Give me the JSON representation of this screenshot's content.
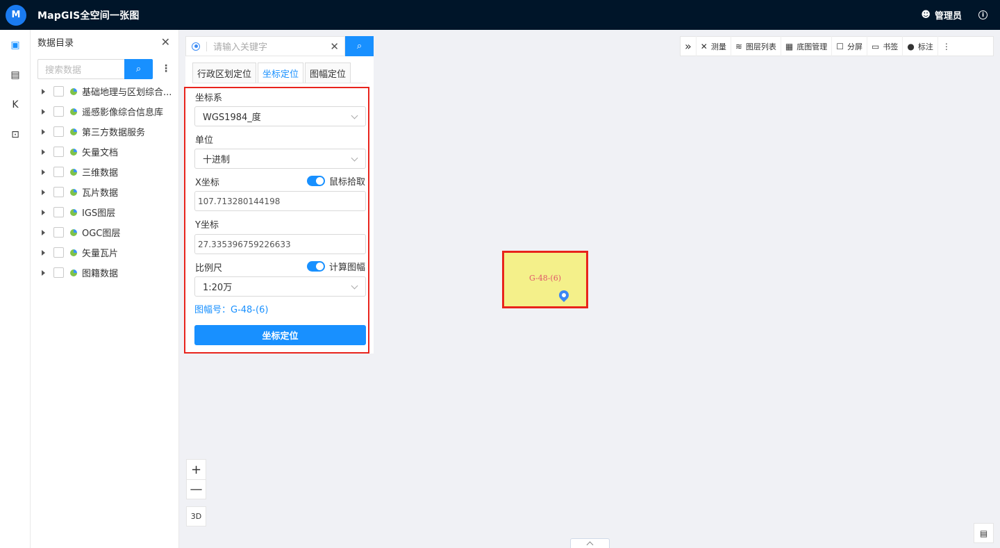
{
  "header": {
    "logo_text": "M",
    "title": "MapGIS全空间一张图",
    "user_icon": "user-icon",
    "user_label": "管理员",
    "info_icon": "i"
  },
  "rail": [
    {
      "icon": "cube-icon",
      "glyph": "▣",
      "active": true
    },
    {
      "icon": "dashboard-icon",
      "glyph": "▤",
      "active": false
    },
    {
      "icon": "k-icon",
      "glyph": "K",
      "active": false
    },
    {
      "icon": "monitor-icon",
      "glyph": "⊡",
      "active": false
    }
  ],
  "catalog": {
    "title": "数据目录",
    "close": "✕",
    "search_placeholder": "搜索数据",
    "search_btn": "⌕",
    "more": "⋮",
    "items": [
      {
        "label": "基础地理与区划综合..."
      },
      {
        "label": "遥感影像综合信息库"
      },
      {
        "label": "第三方数据服务"
      },
      {
        "label": "矢量文档"
      },
      {
        "label": "三维数据"
      },
      {
        "label": "瓦片数据"
      },
      {
        "label": "IGS图层"
      },
      {
        "label": "OGC图层"
      },
      {
        "label": "矢量瓦片"
      },
      {
        "label": "图籍数据"
      }
    ]
  },
  "locate": {
    "search_placeholder": "请输入关键字",
    "clear": "✕",
    "search_btn": "⌕",
    "tabs": [
      {
        "label": "行政区划定位",
        "active": false
      },
      {
        "label": "坐标定位",
        "active": true
      },
      {
        "label": "图幅定位",
        "active": false
      }
    ],
    "crs_label": "坐标系",
    "crs_value": "WGS1984_度",
    "unit_label": "单位",
    "unit_value": "十进制",
    "x_label": "X坐标",
    "pick_toggle": "鼠标拾取",
    "x_value": "107.713280144198",
    "y_label": "Y坐标",
    "y_value": "27.335396759226633",
    "scale_label": "比例尺",
    "calc_toggle": "计算图幅",
    "scale_value": "1:20万",
    "sheet_label": "图幅号：G-48-(6)",
    "submit": "坐标定位"
  },
  "toolbar": {
    "collapse": "»",
    "items": [
      {
        "icon": "measure-icon",
        "glyph": "✕",
        "label": "测量"
      },
      {
        "icon": "layers-icon",
        "glyph": "≋",
        "label": "图层列表"
      },
      {
        "icon": "basemap-icon",
        "glyph": "▦",
        "label": "底图管理"
      },
      {
        "icon": "split-icon",
        "glyph": "☐",
        "label": "分屏"
      },
      {
        "icon": "bookmark-icon",
        "glyph": "▭",
        "label": "书签"
      },
      {
        "icon": "marker-icon",
        "glyph": "●",
        "label": "标注"
      }
    ],
    "more": "⋮"
  },
  "map": {
    "feature_label": "G-48-(6)",
    "zoom_in": "+",
    "zoom_out": "—",
    "mode_3d": "3D",
    "layers_glyph": "▤"
  }
}
